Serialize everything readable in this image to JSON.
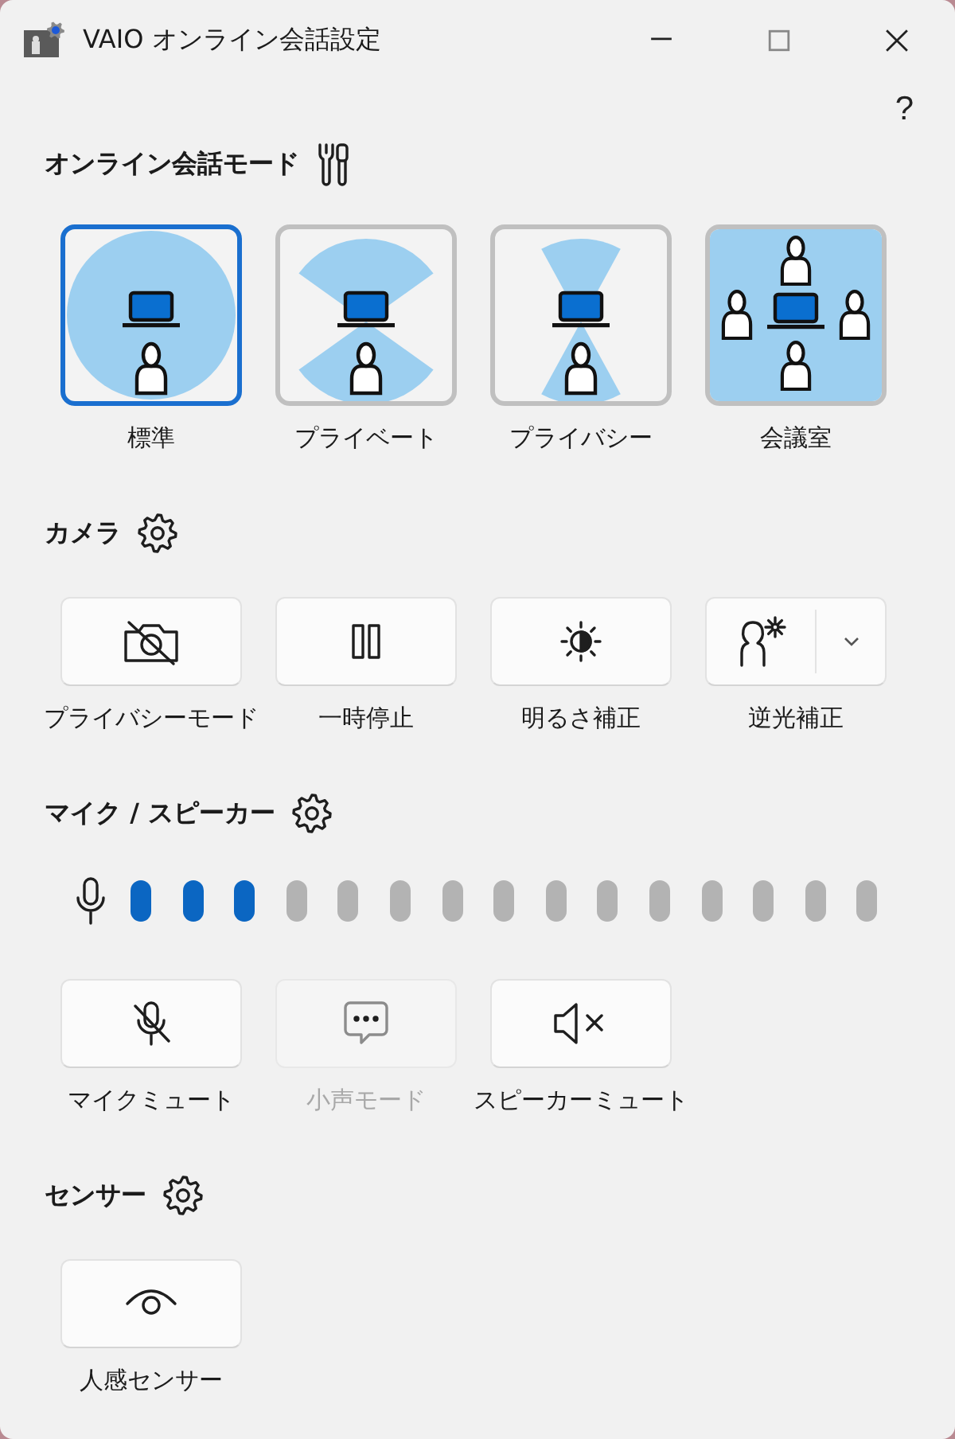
{
  "window": {
    "title": "VAIO オンライン会話設定",
    "help": "?"
  },
  "sections": [
    {
      "kind": "modes",
      "title": "オンライン会話モード",
      "modes": [
        {
          "label": "標準",
          "kind": "standard",
          "selected": true
        },
        {
          "label": "プライベート",
          "kind": "private",
          "selected": false
        },
        {
          "label": "プライバシー",
          "kind": "privacy",
          "selected": false
        },
        {
          "label": "会議室",
          "kind": "conference",
          "selected": false
        }
      ]
    },
    {
      "kind": "buttons",
      "title": "カメラ",
      "buttons": [
        {
          "label": "プライバシーモード",
          "kind": "camera-off",
          "disabled": false,
          "dropdown": false
        },
        {
          "label": "一時停止",
          "kind": "pause",
          "disabled": false,
          "dropdown": false
        },
        {
          "label": "明るさ補正",
          "kind": "brightness",
          "disabled": false,
          "dropdown": false
        },
        {
          "label": "逆光補正",
          "kind": "backlight",
          "disabled": false,
          "dropdown": true
        }
      ]
    },
    {
      "kind": "mic",
      "title": "マイク / スピーカー",
      "level": 0.2,
      "buttons": [
        {
          "label": "マイクミュート",
          "kind": "mic-off",
          "disabled": false,
          "dropdown": false
        },
        {
          "label": "小声モード",
          "kind": "chat",
          "disabled": true,
          "dropdown": false
        },
        {
          "label": "スピーカーミュート",
          "kind": "speaker-mute",
          "disabled": false,
          "dropdown": false
        }
      ]
    },
    {
      "kind": "buttons",
      "title": "センサー",
      "buttons": [
        {
          "label": "人感センサー",
          "kind": "eye",
          "disabled": false,
          "dropdown": false
        }
      ]
    }
  ]
}
